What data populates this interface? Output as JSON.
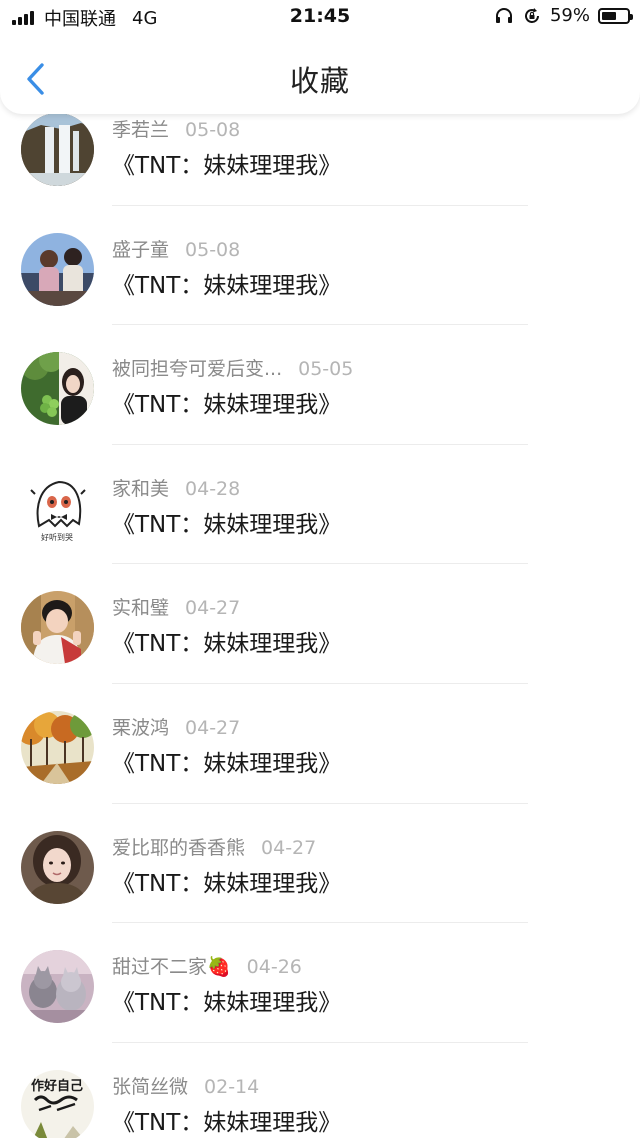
{
  "status_bar": {
    "carrier": "中国联通",
    "network": "4G",
    "time": "21:45",
    "battery_percent": "59%",
    "battery_level": 0.59
  },
  "nav": {
    "title": "收藏"
  },
  "favorites": [
    {
      "author": "季若兰",
      "date": "05-08",
      "title": "《TNT：妹妹理理我》",
      "avatar_icon": "waterfall-avatar"
    },
    {
      "author": "盛子童",
      "date": "05-08",
      "title": "《TNT：妹妹理理我》",
      "avatar_icon": "two-girls-photo-avatar"
    },
    {
      "author": "被同担夸可爱后变...",
      "date": "05-05",
      "title": "《TNT：妹妹理理我》",
      "avatar_icon": "girl-with-grapes-avatar"
    },
    {
      "author": "家和美",
      "date": "04-28",
      "title": "《TNT：妹妹理理我》",
      "avatar_icon": "cartoon-ghost-avatar",
      "avatar_caption": "好听到哭"
    },
    {
      "author": "实和璧",
      "date": "04-27",
      "title": "《TNT：妹妹理理我》",
      "avatar_icon": "boy-portrait-avatar"
    },
    {
      "author": "栗波鸿",
      "date": "04-27",
      "title": "《TNT：妹妹理理我》",
      "avatar_icon": "autumn-trees-avatar"
    },
    {
      "author": "爱比耶的香香熊",
      "date": "04-27",
      "title": "《TNT：妹妹理理我》",
      "avatar_icon": "girl-selfie-avatar"
    },
    {
      "author": "甜过不二家🍓",
      "date": "04-26",
      "title": "《TNT：妹妹理理我》",
      "avatar_icon": "cats-avatar"
    },
    {
      "author": "张简丝微",
      "date": "02-14",
      "title": "《TNT：妹妹理理我》",
      "avatar_icon": "handwriting-avatar",
      "avatar_caption": "作好自己"
    }
  ],
  "colors": {
    "accent_blue": "#3a8ee6",
    "author_gray": "#8a8a8a",
    "date_gray": "#b5b5b5"
  }
}
